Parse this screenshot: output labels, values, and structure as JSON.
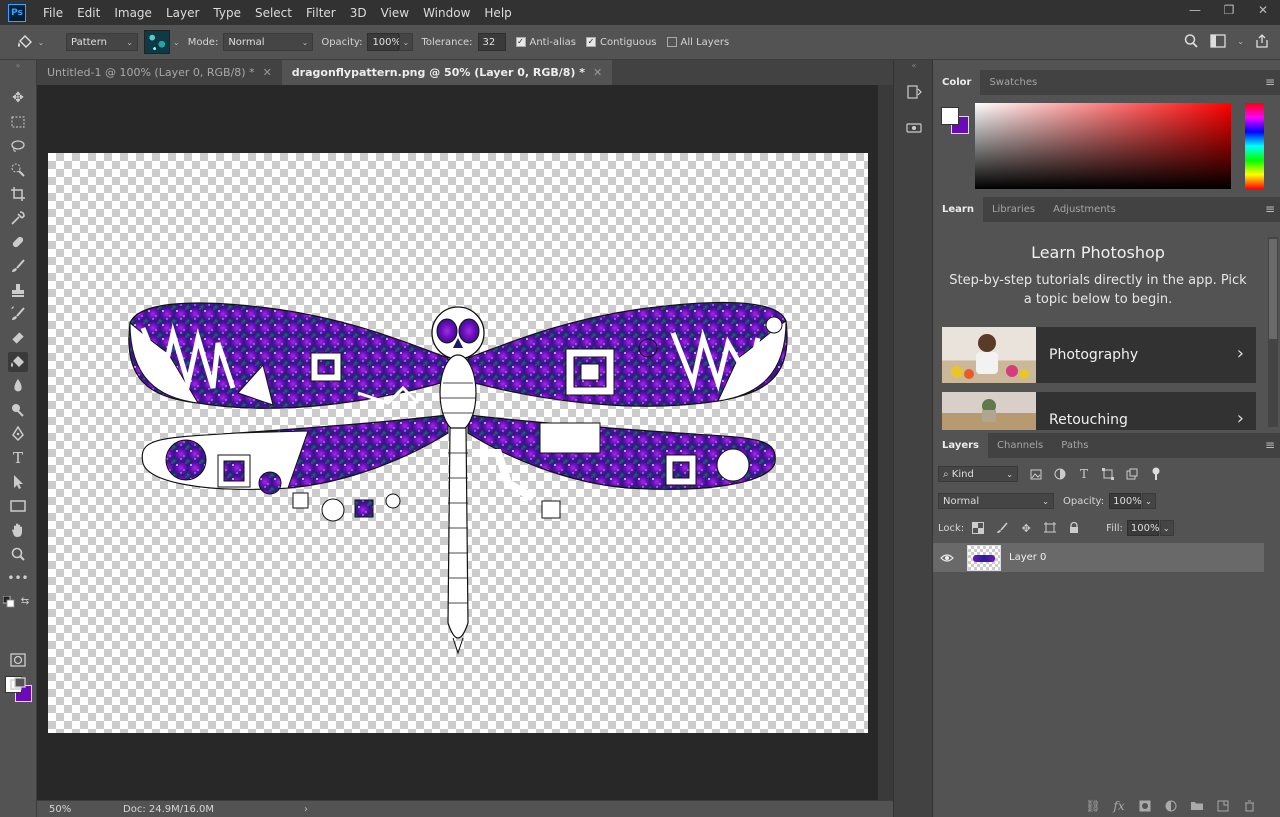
{
  "app": {
    "logo": "Ps"
  },
  "menu": [
    "File",
    "Edit",
    "Image",
    "Layer",
    "Type",
    "Select",
    "Filter",
    "3D",
    "View",
    "Window",
    "Help"
  ],
  "window_controls": [
    "—",
    "❐",
    "✕"
  ],
  "options": {
    "fill_source": "Pattern",
    "mode_label": "Mode:",
    "mode": "Normal",
    "opacity_label": "Opacity:",
    "opacity": "100%",
    "tolerance_label": "Tolerance:",
    "tolerance": "32",
    "anti_alias": "Anti-alias",
    "contiguous": "Contiguous",
    "all_layers": "All Layers"
  },
  "tabs": [
    {
      "label": "Untitled-1 @ 100% (Layer 0, RGB/8) *",
      "active": false
    },
    {
      "label": "dragonflypattern.png @ 50% (Layer 0, RGB/8) *",
      "active": true
    }
  ],
  "status": {
    "zoom": "50%",
    "doc": "Doc: 24.9M/16.0M"
  },
  "color_panel": {
    "tabs": [
      "Color",
      "Swatches"
    ],
    "foreground": "#ffffff",
    "background": "#6a0aba"
  },
  "learn_panel": {
    "tabs": [
      "Learn",
      "Libraries",
      "Adjustments"
    ],
    "title": "Learn Photoshop",
    "description": "Step-by-step tutorials directly in the app. Pick a topic below to begin.",
    "cards": [
      "Photography",
      "Retouching"
    ]
  },
  "layers_panel": {
    "tabs": [
      "Layers",
      "Channels",
      "Paths"
    ],
    "filter_kind": "Kind",
    "blend_mode": "Normal",
    "opacity_label": "Opacity:",
    "opacity": "100%",
    "lock_label": "Lock:",
    "fill_label": "Fill:",
    "fill": "100%",
    "layers": [
      {
        "name": "Layer 0",
        "visible": true
      }
    ]
  },
  "colors": {
    "accent": "#31a8ff",
    "artwork_purple": "#6a0aba",
    "artwork_teal": "#2aa3a3"
  }
}
